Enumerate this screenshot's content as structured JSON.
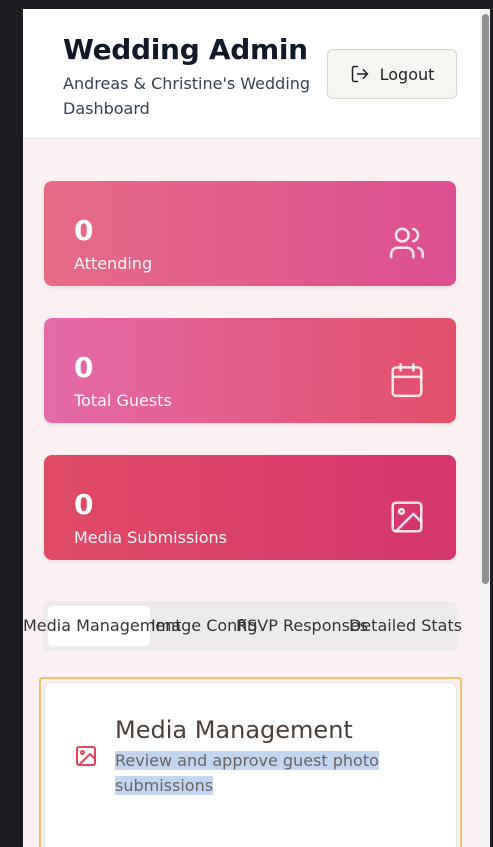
{
  "header": {
    "title": "Wedding Admin",
    "subtitle": "Andreas & Christine's Wedding Dashboard",
    "logout_label": "Logout"
  },
  "stats": [
    {
      "value": "0",
      "label": "Attending",
      "icon": "users-icon"
    },
    {
      "value": "0",
      "label": "Total Guests",
      "icon": "calendar-icon"
    },
    {
      "value": "0",
      "label": "Media Submissions",
      "icon": "image-icon"
    }
  ],
  "tabs": [
    {
      "label": "Media Management",
      "active": true
    },
    {
      "label": "Image Config",
      "active": false
    },
    {
      "label": "RSVP Responses",
      "active": false
    },
    {
      "label": "Detailed Stats",
      "active": false
    }
  ],
  "panel": {
    "title": "Media Management",
    "description": "Review and approve guest photo submissions",
    "icon": "image-icon"
  },
  "colors": {
    "accent": "#dd4f92",
    "panel_icon": "#e0445a",
    "focus_outline": "#f0c36a"
  }
}
